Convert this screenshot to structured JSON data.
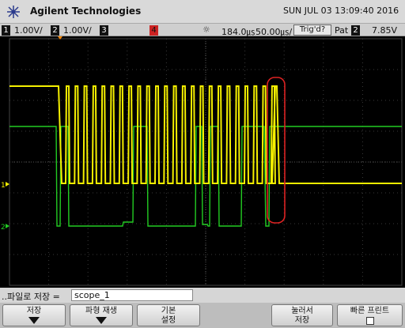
{
  "header": {
    "brand": "Agilent Technologies",
    "datetime": "SUN JUL 03 13:09:40 2016"
  },
  "status": {
    "ch1_num": "1",
    "ch1_scale": "1.00V/",
    "ch2_num": "2",
    "ch2_scale": "1.00V/",
    "ch3_num": "3",
    "ch4_num": "4",
    "run_icon": "run-icon",
    "timebase_delay": "184.0㎲",
    "timebase_scale": "50.00㎲/",
    "trigger_state": "Trig'd?",
    "trigger_mode": "Pat",
    "trigger_source": "2",
    "trigger_level": "7.85V",
    "trigger_edge_icon": "rising-edge-icon"
  },
  "display": {
    "ch1_marker": "1",
    "ch2_marker": "2",
    "ch1_color": "#f5f000",
    "ch2_color": "#22cc22",
    "annotation_color": "#dd2222",
    "grid_divisions": "10x8"
  },
  "file": {
    "label": "..파일로 저장 =",
    "name": "scope_1"
  },
  "softkeys": {
    "save": "저장",
    "waveform_replay_line1": "파형 재생",
    "defaults_line1": "기본",
    "defaults_line2": "설정",
    "press_save_line1": "눌러서",
    "press_save_line2": "저장",
    "quick_print": "빠른 프린트"
  }
}
